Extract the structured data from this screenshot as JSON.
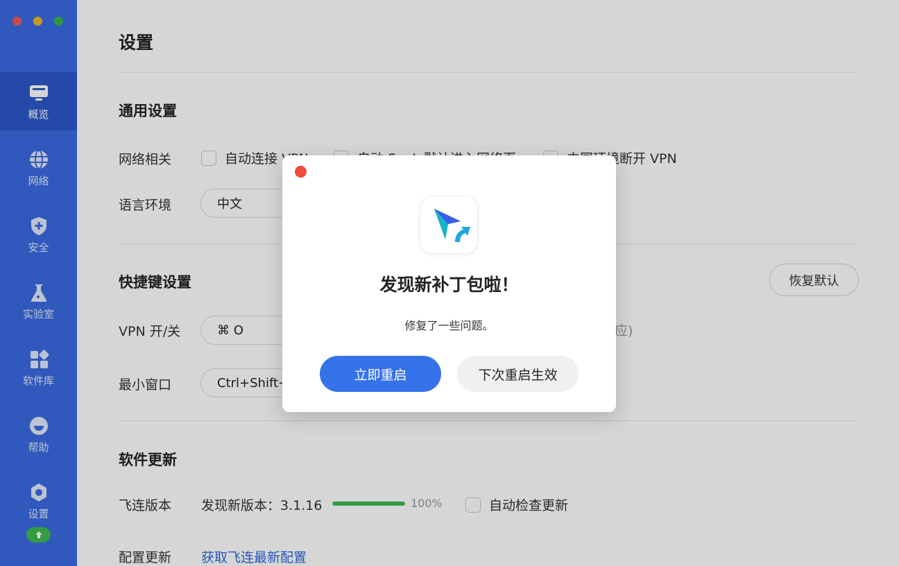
{
  "sidebar": {
    "items": [
      {
        "label": "概览",
        "icon": "monitor-icon",
        "active": true
      },
      {
        "label": "网络",
        "icon": "globe-icon",
        "active": false
      },
      {
        "label": "安全",
        "icon": "shield-icon",
        "active": false
      },
      {
        "label": "实验室",
        "icon": "flask-icon",
        "active": false
      },
      {
        "label": "软件库",
        "icon": "apps-icon",
        "active": false
      },
      {
        "label": "帮助",
        "icon": "help-icon",
        "active": false
      },
      {
        "label": "设置",
        "icon": "gear-icon",
        "active": false
      }
    ],
    "update_badge_icon": "arrow-up-icon"
  },
  "main": {
    "title": "设置",
    "general": {
      "title": "通用设置",
      "network_label": "网络相关",
      "checkboxes": [
        "自动连接 VPN",
        "自动 SaaL 默认进入网络页",
        "中国环境断开 VPN"
      ],
      "language_label": "语言环境",
      "language_value": "中文"
    },
    "shortcuts": {
      "title": "快捷键设置",
      "restore_label": "恢复默认",
      "vpn_label": "VPN 开/关",
      "vpn_value": "⌘ O",
      "minimize_label": "最小窗口",
      "minimize_value": "Ctrl+Shift+",
      "hint_partial": "应)"
    },
    "update": {
      "title": "软件更新",
      "version_label": "飞连版本",
      "version_text": "发现新版本：3.1.16",
      "progress": 1.0,
      "progress_text": "100%",
      "auto_check_label": "自动检查更新",
      "config_label": "配置更新",
      "config_link": "获取飞连最新配置"
    }
  },
  "dialog": {
    "title": "发现新补丁包啦！",
    "message": "修复了一些问题。",
    "primary_button": "立即重启",
    "secondary_button": "下次重启生效",
    "logo_icon": "app-logo-icon"
  },
  "colors": {
    "sidebar_bg": "#3b6be2",
    "sidebar_active": "#2d58c9",
    "primary": "#3673ea",
    "progress": "#3fb950",
    "link": "#2d67e0",
    "close": "#ee4b40"
  }
}
